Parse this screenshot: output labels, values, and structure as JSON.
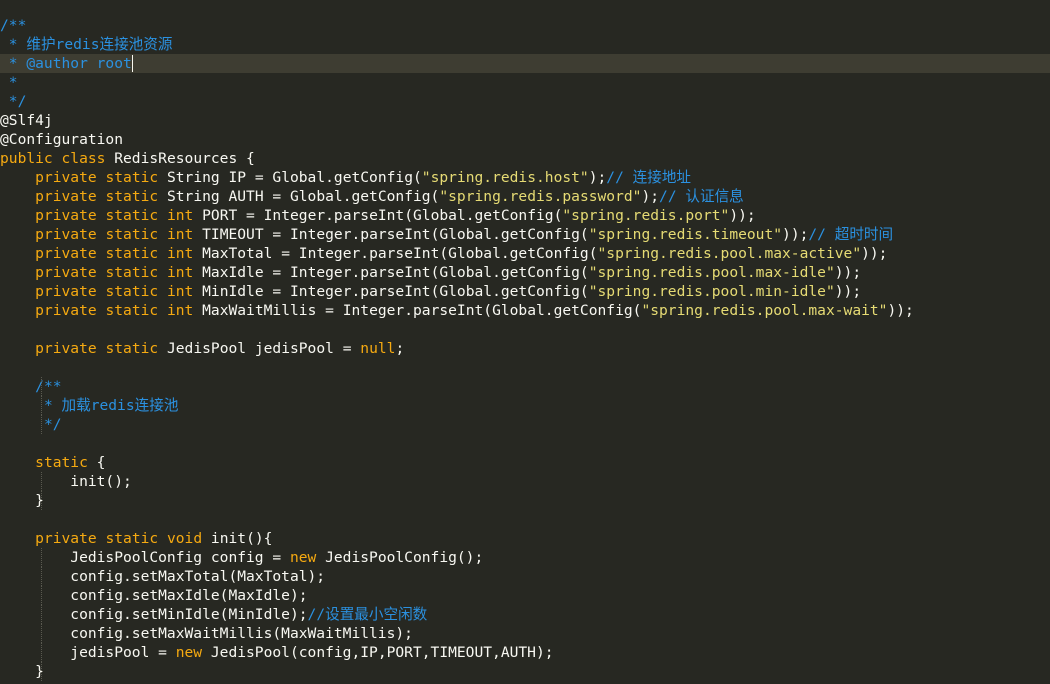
{
  "editor": {
    "theme": {
      "background": "#272822",
      "current_line": "#3e3d32",
      "colors": {
        "pl": "#f8f8f2",
        "kw": "#f6aa11",
        "st": "#e6db74",
        "cm": "#2b91e0",
        "nl": "#f6aa11",
        "op": "#f8f8f2"
      }
    },
    "current_line_index": 2,
    "lines": [
      {
        "t": [
          [
            "cm",
            "/**"
          ]
        ]
      },
      {
        "t": [
          [
            "cm",
            " * 维护redis连接池资源"
          ]
        ]
      },
      {
        "t": [
          [
            "cm",
            " * @author root"
          ]
        ],
        "caret": true
      },
      {
        "t": [
          [
            "cm",
            " *"
          ]
        ]
      },
      {
        "t": [
          [
            "cm",
            " */"
          ]
        ]
      },
      {
        "t": [
          [
            "pl",
            "@Slf4j"
          ]
        ]
      },
      {
        "t": [
          [
            "pl",
            "@Configuration"
          ]
        ]
      },
      {
        "t": [
          [
            "kw",
            "public"
          ],
          [
            "pl",
            " "
          ],
          [
            "kw",
            "class"
          ],
          [
            "pl",
            " RedisResources {"
          ]
        ]
      },
      {
        "t": [
          [
            "pl",
            "    "
          ],
          [
            "kw",
            "private"
          ],
          [
            "pl",
            " "
          ],
          [
            "kw",
            "static"
          ],
          [
            "pl",
            " String IP = Global.getConfig("
          ],
          [
            "st",
            "\"spring.redis.host\""
          ],
          [
            "pl",
            ");"
          ],
          [
            "cm",
            "// 连接地址"
          ]
        ]
      },
      {
        "t": [
          [
            "pl",
            "    "
          ],
          [
            "kw",
            "private"
          ],
          [
            "pl",
            " "
          ],
          [
            "kw",
            "static"
          ],
          [
            "pl",
            " String AUTH = Global.getConfig("
          ],
          [
            "st",
            "\"spring.redis.password\""
          ],
          [
            "pl",
            ");"
          ],
          [
            "cm",
            "// 认证信息"
          ]
        ]
      },
      {
        "t": [
          [
            "pl",
            "    "
          ],
          [
            "kw",
            "private"
          ],
          [
            "pl",
            " "
          ],
          [
            "kw",
            "static"
          ],
          [
            "pl",
            " "
          ],
          [
            "kw",
            "int"
          ],
          [
            "pl",
            " PORT = Integer.parseInt(Global.getConfig("
          ],
          [
            "st",
            "\"spring.redis.port\""
          ],
          [
            "pl",
            "));"
          ]
        ]
      },
      {
        "t": [
          [
            "pl",
            "    "
          ],
          [
            "kw",
            "private"
          ],
          [
            "pl",
            " "
          ],
          [
            "kw",
            "static"
          ],
          [
            "pl",
            " "
          ],
          [
            "kw",
            "int"
          ],
          [
            "pl",
            " TIMEOUT = Integer.parseInt(Global.getConfig("
          ],
          [
            "st",
            "\"spring.redis.timeout\""
          ],
          [
            "pl",
            "));"
          ],
          [
            "cm",
            "// 超时时间"
          ]
        ]
      },
      {
        "t": [
          [
            "pl",
            "    "
          ],
          [
            "kw",
            "private"
          ],
          [
            "pl",
            " "
          ],
          [
            "kw",
            "static"
          ],
          [
            "pl",
            " "
          ],
          [
            "kw",
            "int"
          ],
          [
            "pl",
            " MaxTotal = Integer.parseInt(Global.getConfig("
          ],
          [
            "st",
            "\"spring.redis.pool.max-active\""
          ],
          [
            "pl",
            "));"
          ]
        ]
      },
      {
        "t": [
          [
            "pl",
            "    "
          ],
          [
            "kw",
            "private"
          ],
          [
            "pl",
            " "
          ],
          [
            "kw",
            "static"
          ],
          [
            "pl",
            " "
          ],
          [
            "kw",
            "int"
          ],
          [
            "pl",
            " MaxIdle = Integer.parseInt(Global.getConfig("
          ],
          [
            "st",
            "\"spring.redis.pool.max-idle\""
          ],
          [
            "pl",
            "));"
          ]
        ]
      },
      {
        "t": [
          [
            "pl",
            "    "
          ],
          [
            "kw",
            "private"
          ],
          [
            "pl",
            " "
          ],
          [
            "kw",
            "static"
          ],
          [
            "pl",
            " "
          ],
          [
            "kw",
            "int"
          ],
          [
            "pl",
            " MinIdle = Integer.parseInt(Global.getConfig("
          ],
          [
            "st",
            "\"spring.redis.pool.min-idle\""
          ],
          [
            "pl",
            "));"
          ]
        ]
      },
      {
        "t": [
          [
            "pl",
            "    "
          ],
          [
            "kw",
            "private"
          ],
          [
            "pl",
            " "
          ],
          [
            "kw",
            "static"
          ],
          [
            "pl",
            " "
          ],
          [
            "kw",
            "int"
          ],
          [
            "pl",
            " MaxWaitMillis = Integer.parseInt(Global.getConfig("
          ],
          [
            "st",
            "\"spring.redis.pool.max-wait\""
          ],
          [
            "pl",
            "));"
          ]
        ]
      },
      {
        "t": []
      },
      {
        "t": [
          [
            "pl",
            "    "
          ],
          [
            "kw",
            "private"
          ],
          [
            "pl",
            " "
          ],
          [
            "kw",
            "static"
          ],
          [
            "pl",
            " JedisPool jedisPool = "
          ],
          [
            "nl",
            "null"
          ],
          [
            "pl",
            ";"
          ]
        ]
      },
      {
        "t": []
      },
      {
        "t": [
          [
            "pl",
            "    "
          ],
          [
            "cm",
            "/**"
          ]
        ],
        "guides": [
          1
        ]
      },
      {
        "t": [
          [
            "pl",
            "    "
          ],
          [
            "cm",
            " * 加载redis连接池"
          ]
        ],
        "guides": [
          1
        ]
      },
      {
        "t": [
          [
            "pl",
            "    "
          ],
          [
            "cm",
            " */"
          ]
        ],
        "guides": [
          1
        ]
      },
      {
        "t": []
      },
      {
        "t": [
          [
            "pl",
            "    "
          ],
          [
            "kw",
            "static"
          ],
          [
            "pl",
            " {"
          ]
        ]
      },
      {
        "t": [
          [
            "pl",
            "        init();"
          ]
        ],
        "guides": [
          1
        ]
      },
      {
        "t": [
          [
            "pl",
            "    }"
          ]
        ],
        "guides": [
          1
        ]
      },
      {
        "t": []
      },
      {
        "t": [
          [
            "pl",
            "    "
          ],
          [
            "kw",
            "private"
          ],
          [
            "pl",
            " "
          ],
          [
            "kw",
            "static"
          ],
          [
            "pl",
            " "
          ],
          [
            "kw",
            "void"
          ],
          [
            "pl",
            " init(){"
          ]
        ]
      },
      {
        "t": [
          [
            "pl",
            "        JedisPoolConfig config = "
          ],
          [
            "kw",
            "new"
          ],
          [
            "pl",
            " JedisPoolConfig();"
          ]
        ],
        "guides": [
          1
        ]
      },
      {
        "t": [
          [
            "pl",
            "        config.setMaxTotal(MaxTotal);"
          ]
        ],
        "guides": [
          1
        ]
      },
      {
        "t": [
          [
            "pl",
            "        config.setMaxIdle(MaxIdle);"
          ]
        ],
        "guides": [
          1
        ]
      },
      {
        "t": [
          [
            "pl",
            "        config.setMinIdle(MinIdle);"
          ],
          [
            "cm",
            "//设置最小空闲数"
          ]
        ],
        "guides": [
          1
        ]
      },
      {
        "t": [
          [
            "pl",
            "        config.setMaxWaitMillis(MaxWaitMillis);"
          ]
        ],
        "guides": [
          1
        ]
      },
      {
        "t": [
          [
            "pl",
            "        jedisPool = "
          ],
          [
            "kw",
            "new"
          ],
          [
            "pl",
            " JedisPool(config,IP,PORT,TIMEOUT,AUTH);"
          ]
        ],
        "guides": [
          1
        ]
      },
      {
        "t": [
          [
            "pl",
            "    }"
          ]
        ],
        "guides": [
          1
        ]
      }
    ]
  }
}
